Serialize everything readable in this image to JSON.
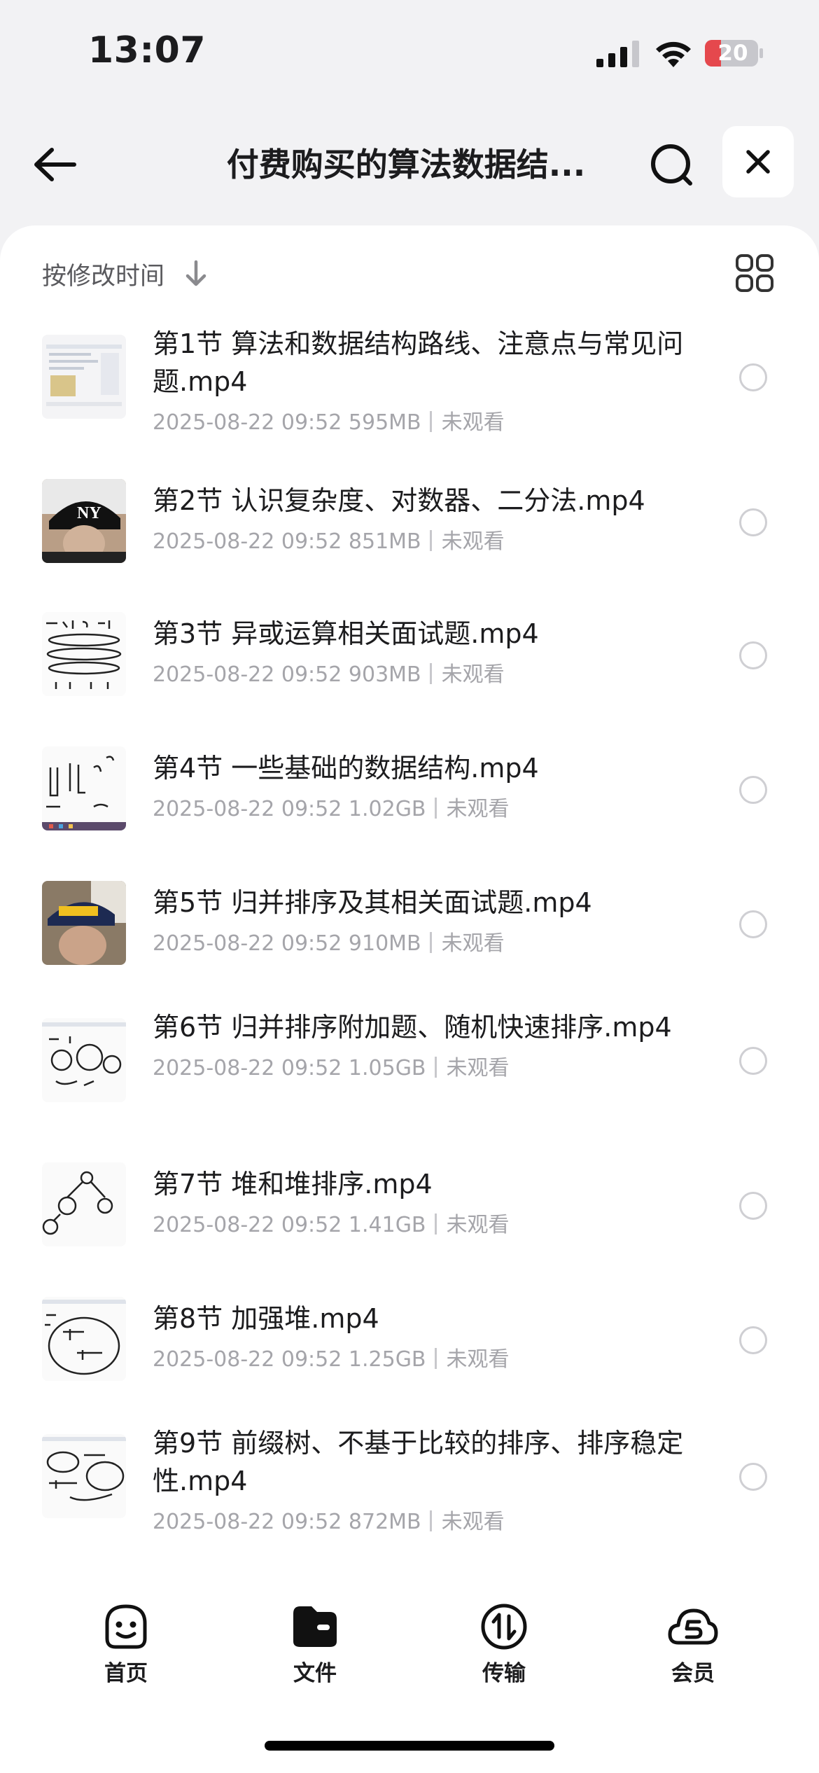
{
  "status_bar": {
    "time": "13:07",
    "battery": "20"
  },
  "nav": {
    "title": "付费购买的算法数据结..."
  },
  "sort": {
    "label": "按修改时间"
  },
  "files": [
    {
      "name": "第1节 算法和数据结构路线、注意点与常见问题.mp4",
      "date": "2025-08-22 09:52",
      "size": "595MB",
      "status": "未观看"
    },
    {
      "name": "第2节 认识复杂度、对数器、二分法.mp4",
      "date": "2025-08-22 09:52",
      "size": "851MB",
      "status": "未观看"
    },
    {
      "name": "第3节 异或运算相关面试题.mp4",
      "date": "2025-08-22 09:52",
      "size": "903MB",
      "status": "未观看"
    },
    {
      "name": "第4节 一些基础的数据结构.mp4",
      "date": "2025-08-22 09:52",
      "size": "1.02GB",
      "status": "未观看"
    },
    {
      "name": "第5节 归并排序及其相关面试题.mp4",
      "date": "2025-08-22 09:52",
      "size": "910MB",
      "status": "未观看"
    },
    {
      "name": "第6节 归并排序附加题、随机快速排序.mp4",
      "date": "2025-08-22 09:52",
      "size": "1.05GB",
      "status": "未观看"
    },
    {
      "name": "第7节 堆和堆排序.mp4",
      "date": "2025-08-22 09:52",
      "size": "1.41GB",
      "status": "未观看"
    },
    {
      "name": "第8节 加强堆.mp4",
      "date": "2025-08-22 09:52",
      "size": "1.25GB",
      "status": "未观看"
    },
    {
      "name": "第9节 前缀树、不基于比较的排序、排序稳定性.mp4",
      "date": "2025-08-22 09:52",
      "size": "872MB",
      "status": "未观看"
    }
  ],
  "tabs": [
    {
      "label": "首页",
      "icon": "smiley-face-icon"
    },
    {
      "label": "文件",
      "icon": "folder-icon"
    },
    {
      "label": "传输",
      "icon": "transfer-icon"
    },
    {
      "label": "会员",
      "icon": "vip-cloud-icon"
    }
  ],
  "colors": {
    "battery_low": "#e5484d",
    "accent": "#1c1c1e"
  }
}
